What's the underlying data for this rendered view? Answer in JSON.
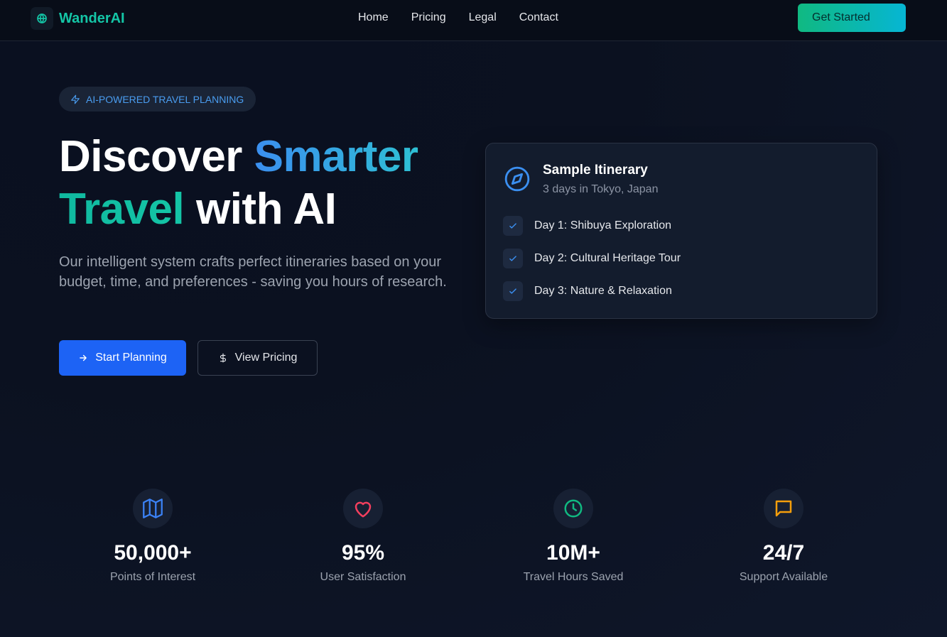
{
  "brand": {
    "name": "WanderAI"
  },
  "nav": {
    "links": [
      "Home",
      "Pricing",
      "Legal",
      "Contact"
    ],
    "cta": "Get Started"
  },
  "hero": {
    "badge": "AI-POWERED TRAVEL PLANNING",
    "title_part1": "Discover ",
    "title_part2": "Smarter",
    "title_part3": "Travel",
    "title_part4": " with AI",
    "lead": "Our intelligent system crafts perfect itineraries based on your budget, time, and preferences - saving you hours of research.",
    "primary_button": "Start Planning",
    "secondary_button": "View Pricing"
  },
  "itinerary_card": {
    "title": "Sample Itinerary",
    "subtitle": "3 days in Tokyo, Japan",
    "items": [
      "Day 1: Shibuya Exploration",
      "Day 2: Cultural Heritage Tour",
      "Day 3: Nature & Relaxation"
    ]
  },
  "stats": [
    {
      "icon": "map-icon",
      "value": "50,000+",
      "label": "Points of Interest",
      "color": "#3b82f6"
    },
    {
      "icon": "heart-icon",
      "value": "95%",
      "label": "User Satisfaction",
      "color": "#f43f5e"
    },
    {
      "icon": "clock-icon",
      "value": "10M+",
      "label": "Travel Hours Saved",
      "color": "#10b981"
    },
    {
      "icon": "message-icon",
      "value": "24/7",
      "label": "Support Available",
      "color": "#f59e0b"
    }
  ],
  "colors": {
    "accent_teal": "#14c5a6",
    "accent_blue": "#3ea3ee",
    "primary_button": "#1d63f5",
    "background": "#0b1120"
  }
}
